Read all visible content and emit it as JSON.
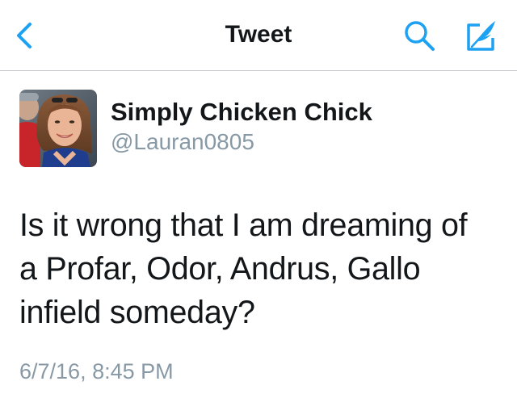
{
  "nav": {
    "title": "Tweet",
    "back_icon": "chevron-left-icon",
    "search_icon": "search-icon",
    "compose_icon": "compose-icon",
    "accent_color": "#1da1f2"
  },
  "author": {
    "display_name": "Simply Chicken Chick",
    "handle": "@Lauran0805",
    "avatar": "profile-photo"
  },
  "tweet": {
    "text_lines": [
      "Is it wrong that I am dreaming of",
      "a Profar, Odor, Andrus, Gallo",
      "infield someday?"
    ],
    "timestamp": "6/7/16, 8:45 PM"
  }
}
